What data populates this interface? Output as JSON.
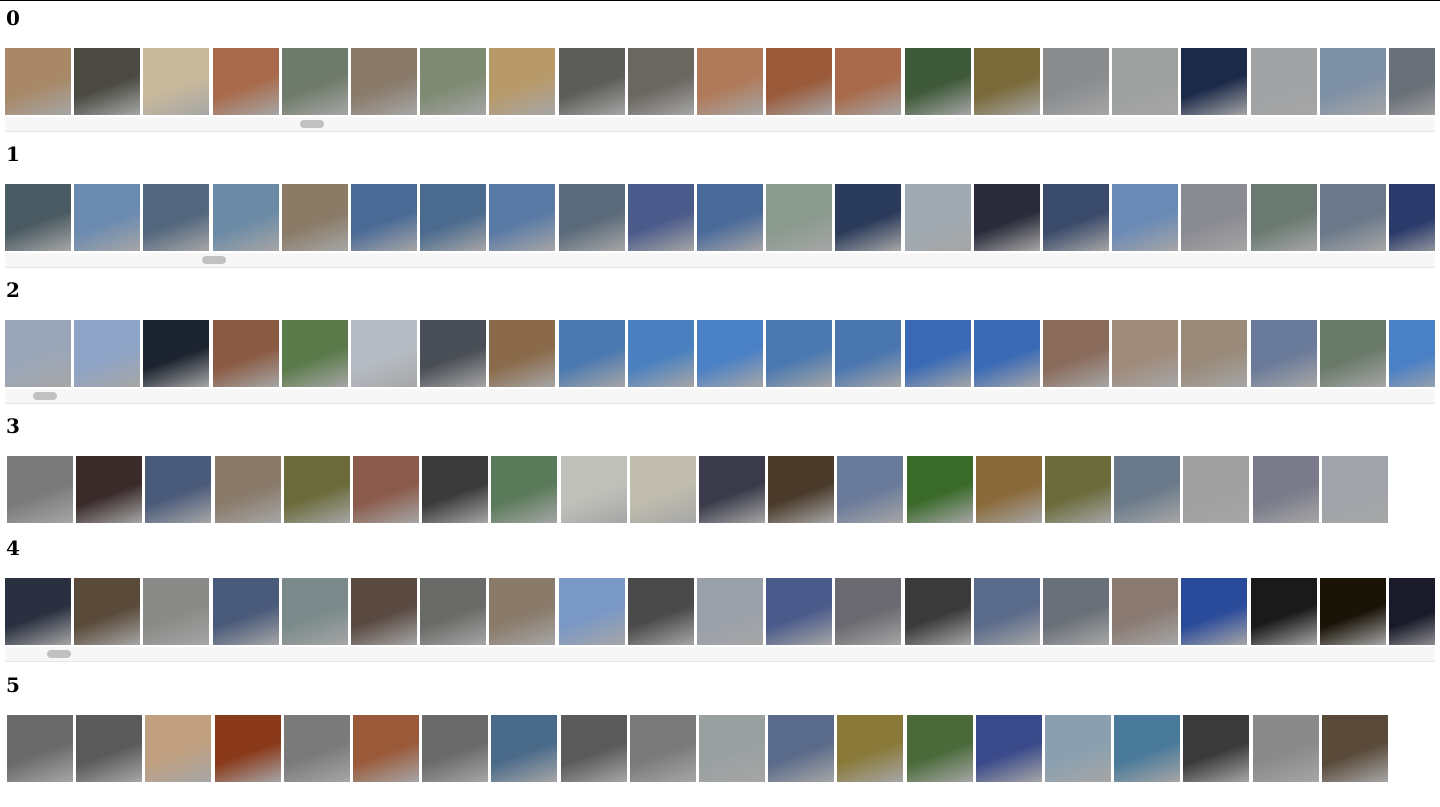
{
  "rows": [
    {
      "title": "0",
      "scroll_position": 0.21,
      "thumbs": [
        "#a88866",
        "#4a4a42",
        "#c9b99b",
        "#a86a4a",
        "#6f7b6a",
        "#8a7a6a",
        "#7e8a72",
        "#b89a6a",
        "#5c5c58",
        "#6a6660",
        "#b07a5a",
        "#9a5a3a",
        "#a86a4a",
        "#3f5a3a",
        "#7a6a3a",
        "#8a8c8e",
        "#9ea0a0",
        "#1c2a4a",
        "#a0a2a4",
        "#7e90a6",
        "#6a7078"
      ]
    },
    {
      "title": "1",
      "scroll_position": 0.14,
      "thumbs": [
        "#4a5a62",
        "#6a8ab0",
        "#52667e",
        "#6a8aa6",
        "#8a7a66",
        "#4a6a96",
        "#4a6a8e",
        "#5a7aa6",
        "#5a6a7a",
        "#4a5a8a",
        "#4a6a9a",
        "#8a9a8e",
        "#2a3a5a",
        "#a0aab2",
        "#2a2a3a",
        "#3a4a6a",
        "#6a8ab6",
        "#8a8a92",
        "#6a7a72",
        "#6a788a",
        "#2a3a6a"
      ]
    },
    {
      "title": "2",
      "scroll_position": 0.02,
      "thumbs": [
        "#9aa6b8",
        "#8ea4c6",
        "#1c2430",
        "#8a5a42",
        "#5a7a4a",
        "#b6bcc4",
        "#4a4e56",
        "#8a6a4a",
        "#4a78b0",
        "#4a80c0",
        "#4a80c6",
        "#4a78b0",
        "#4a76b0",
        "#3a6ab6",
        "#3a6ab6",
        "#8a6a5a",
        "#a08a7a",
        "#9a8a7a",
        "#6a7a9a",
        "#6a7a6a",
        "#4a80c6"
      ]
    },
    {
      "title": "3",
      "scroll_position": null,
      "thumbs": [
        "#7a7a7a",
        "#3a2a2a",
        "#4a5a7a",
        "#8a7a6a",
        "#6a6a3a",
        "#8a5a4a",
        "#3a3a3a",
        "#5a7a5a",
        "#c0c0ba",
        "#c0bcae",
        "#3a3a4a",
        "#4a3a2a",
        "#6a7a9a",
        "#3a6a2a",
        "#8a6a3a",
        "#6a6a3a",
        "#6a7a8a",
        "#a0a0a0",
        "#7a7a8a",
        "#a0a4aa"
      ]
    },
    {
      "title": "4",
      "scroll_position": 0.03,
      "thumbs": [
        "#2a3040",
        "#5a4a3a",
        "#8a8a88",
        "#4a5a7a",
        "#7a8a8a",
        "#5a4a42",
        "#6a6a68",
        "#8a7a6a",
        "#7a98c6",
        "#4a4a4a",
        "#9aa0aa",
        "#4a5a8a",
        "#6a6a70",
        "#3a3a3a",
        "#5a6a8a",
        "#6a7078",
        "#8a7a72",
        "#2a4a9a",
        "#1a1a1a",
        "#1a1408",
        "#1a1a2a"
      ]
    },
    {
      "title": "5",
      "scroll_position": null,
      "thumbs": [
        "#6a6a6a",
        "#5a5a5a",
        "#c0a080",
        "#8a3a1a",
        "#7a7a7a",
        "#9a5a3a",
        "#6a6a6a",
        "#4a6a8a",
        "#5a5a5a",
        "#7a7a7a",
        "#9aa0a0",
        "#5a6a8a",
        "#8a7a3a",
        "#4a6a3a",
        "#3a4a8a",
        "#8aa0b0",
        "#4a7a9a",
        "#3a3a3a",
        "#8a8a8a",
        "#5a4a3a"
      ]
    }
  ]
}
